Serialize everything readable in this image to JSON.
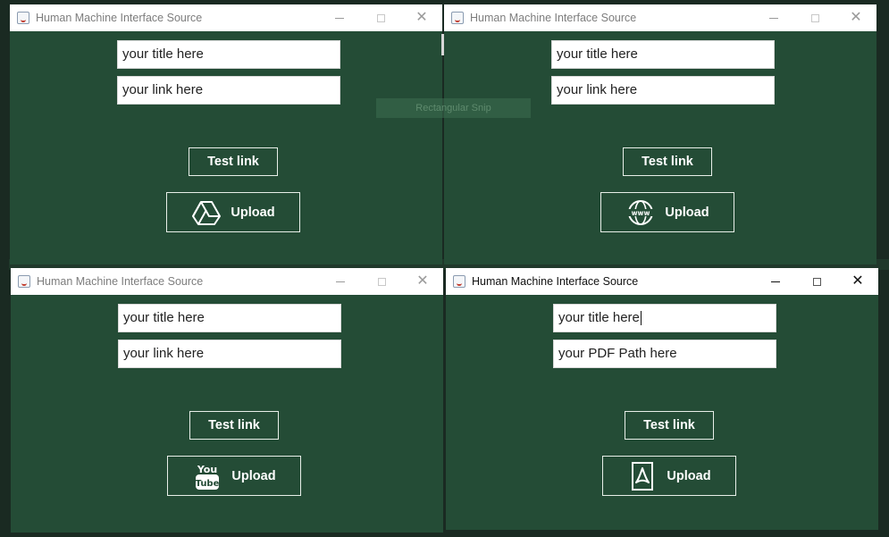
{
  "windows": [
    {
      "title": "Human Machine Interface Source",
      "title_value": "your title here",
      "link_value": "your link here",
      "test_label": "Test link",
      "upload_label": "Upload",
      "upload_icon": "google-drive-icon",
      "active": false
    },
    {
      "title": "Human Machine Interface Source",
      "title_value": "your title here",
      "link_value": "your link here",
      "test_label": "Test link",
      "upload_label": "Upload",
      "upload_icon": "www-globe-icon",
      "active": false
    },
    {
      "title": "Human Machine Interface Source",
      "title_value": "your title here",
      "link_value": "your link here",
      "test_label": "Test link",
      "upload_label": "Upload",
      "upload_icon": "youtube-icon",
      "active": false
    },
    {
      "title": "Human Machine Interface Source",
      "title_value": "your title here",
      "link_value": "your PDF Path here",
      "test_label": "Test link",
      "upload_label": "Upload",
      "upload_icon": "pdf-icon",
      "active": true
    }
  ],
  "overlay": {
    "snip_label": "Rectangular Snip"
  },
  "colors": {
    "window_bg": "#244c36",
    "titlebar": "#ffffff",
    "button_border": "#e8efe9"
  }
}
